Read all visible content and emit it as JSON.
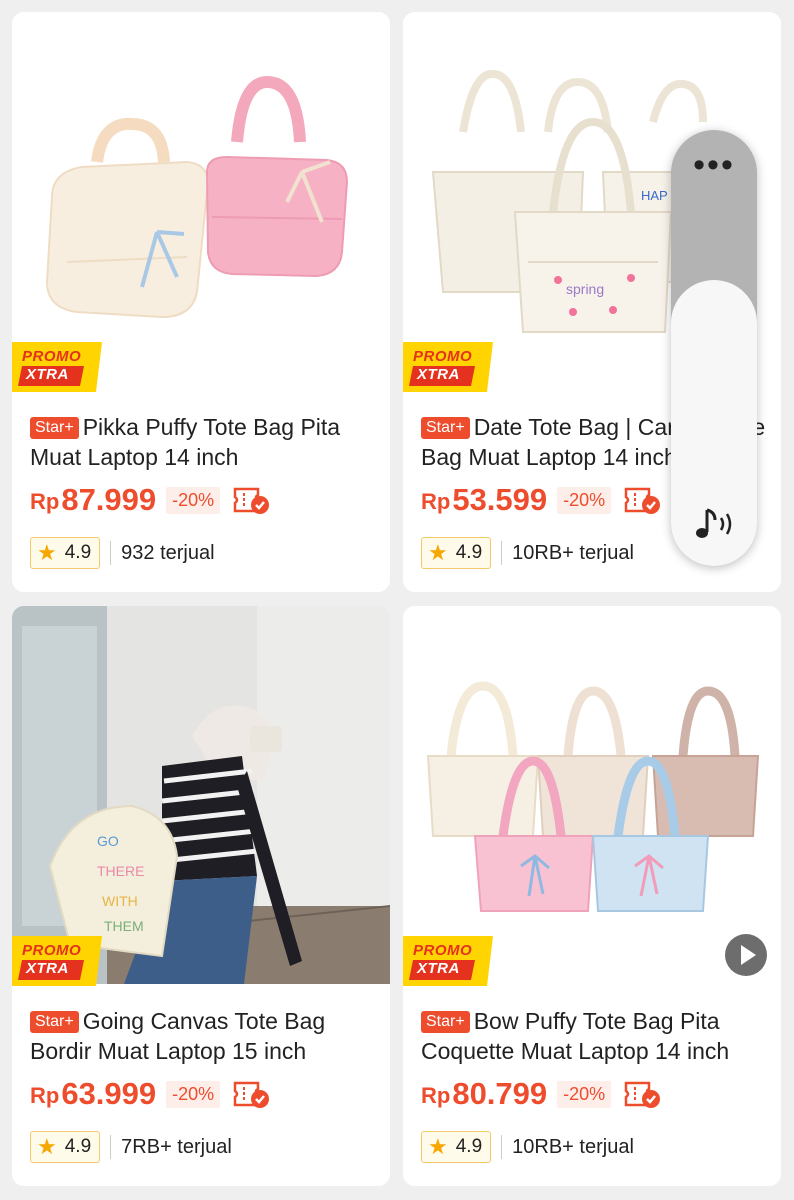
{
  "products": [
    {
      "promo_line1": "PROMO",
      "promo_line2": "XTRA",
      "badge": "Star+",
      "title": "Pikka Puffy Tote Bag Pita Muat Laptop 14 inch",
      "currency": "Rp",
      "price": "87.999",
      "discount": "-20%",
      "rating": "4.9",
      "sold": "932 terjual"
    },
    {
      "promo_line1": "PROMO",
      "promo_line2": "XTRA",
      "badge": "Star+",
      "title": "Date Tote Bag | Canvas Tote Bag Muat Laptop 14 inch",
      "currency": "Rp",
      "price": "53.599",
      "discount": "-20%",
      "rating": "4.9",
      "sold": "10RB+ terjual"
    },
    {
      "promo_line1": "PROMO",
      "promo_line2": "XTRA",
      "badge": "Star+",
      "title": "Going Canvas Tote Bag Bordir Muat Laptop 15 inch",
      "currency": "Rp",
      "price": "63.999",
      "discount": "-20%",
      "rating": "4.9",
      "sold": "7RB+ terjual"
    },
    {
      "promo_line1": "PROMO",
      "promo_line2": "XTRA",
      "badge": "Star+",
      "title": "Bow Puffy Tote Bag Pita Coquette Muat Laptop 14 inch",
      "currency": "Rp",
      "price": "80.799",
      "discount": "-20%",
      "rating": "4.9",
      "sold": "10RB+ terjual"
    }
  ],
  "overlay": {
    "menu_glyph": "•••",
    "icon": "sound-wave-icon"
  },
  "icons": {
    "voucher": "voucher-check-icon",
    "star": "star-icon",
    "play": "play-icon"
  },
  "colors": {
    "accent": "#ee4d2d",
    "promo_yellow": "#ffd400",
    "rating_star": "#f6a700"
  }
}
